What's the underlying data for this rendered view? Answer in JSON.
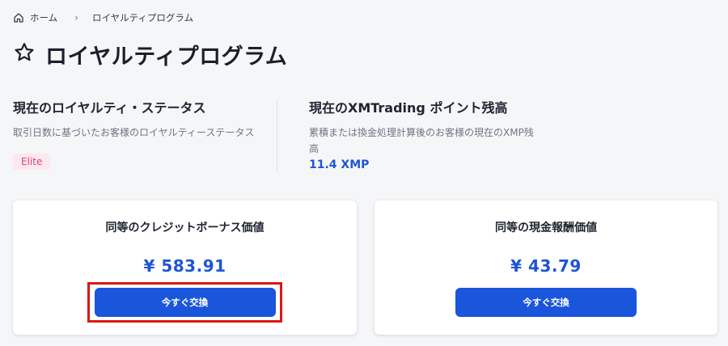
{
  "breadcrumb": {
    "home_label": "ホーム",
    "current_label": "ロイヤルティプログラム"
  },
  "page": {
    "title": "ロイヤルティプログラム"
  },
  "loyalty_status": {
    "title": "現在のロイヤルティ・ステータス",
    "description": "取引日数に基づいたお客様のロイヤルティーステータス",
    "badge": "Elite"
  },
  "points_balance": {
    "title": "現在のXMTrading ポイント残高",
    "description_line1": "累積または換金処理計算後のお客様の現在のXMP残",
    "description_line2": "高",
    "value": "11.4 XMP"
  },
  "credit_bonus_card": {
    "label": "同等のクレジットボーナス価値",
    "value": "¥ 583.91",
    "button_label": "今すぐ交換"
  },
  "cash_reward_card": {
    "label": "同等の現金報酬価値",
    "value": "¥ 43.79",
    "button_label": "今すぐ交換"
  },
  "colors": {
    "accent_blue": "#1a56db",
    "value_blue": "#1f55d4",
    "badge_bg": "#fde8ef",
    "badge_text": "#d9487a",
    "highlight_red": "#e01515"
  }
}
